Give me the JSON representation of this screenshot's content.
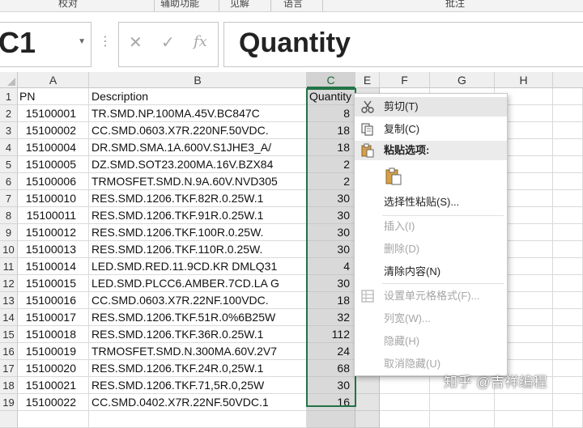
{
  "ribbon": {
    "groups": [
      "校对",
      "辅助功能",
      "见解",
      "语言",
      "批注"
    ]
  },
  "formula_bar": {
    "name_box": "C1",
    "formula": "Quantity",
    "cancel_glyph": "✕",
    "enter_glyph": "✓",
    "fx_glyph": "fx"
  },
  "columns": [
    "A",
    "B",
    "C",
    "E",
    "F",
    "G",
    "H"
  ],
  "header_row": {
    "row": "1",
    "pn": "PN",
    "description": "Description",
    "quantity": "Quantity"
  },
  "rows": [
    {
      "row": "2",
      "pn": "15100001",
      "description": "TR.SMD.NP.100MA.45V.BC847C",
      "quantity": "8"
    },
    {
      "row": "3",
      "pn": "15100002",
      "description": "CC.SMD.0603.X7R.220NF.50VDC.",
      "quantity": "18"
    },
    {
      "row": "4",
      "pn": "15100004",
      "description": "DR.SMD.SMA.1A.600V.S1JHE3_A/",
      "quantity": "18"
    },
    {
      "row": "5",
      "pn": "15100005",
      "description": "DZ.SMD.SOT23.200MA.16V.BZX84",
      "quantity": "2"
    },
    {
      "row": "6",
      "pn": "15100006",
      "description": "TRMOSFET.SMD.N.9A.60V.NVD305",
      "quantity": "2"
    },
    {
      "row": "7",
      "pn": "15100010",
      "description": "RES.SMD.1206.TKF.82R.0.25W.1",
      "quantity": "30"
    },
    {
      "row": "8",
      "pn": "15100011",
      "description": "RES.SMD.1206.TKF.91R.0.25W.1",
      "quantity": "30"
    },
    {
      "row": "9",
      "pn": "15100012",
      "description": "RES.SMD.1206.TKF.100R.0.25W.",
      "quantity": "30"
    },
    {
      "row": "10",
      "pn": "15100013",
      "description": "RES.SMD.1206.TKF.110R.0.25W.",
      "quantity": "30"
    },
    {
      "row": "11",
      "pn": "15100014",
      "description": "LED.SMD.RED.11.9CD.KR DMLQ31",
      "quantity": "4"
    },
    {
      "row": "12",
      "pn": "15100015",
      "description": "LED.SMD.PLCC6.AMBER.7CD.LA G",
      "quantity": "30"
    },
    {
      "row": "13",
      "pn": "15100016",
      "description": "CC.SMD.0603.X7R.22NF.100VDC.",
      "quantity": "18"
    },
    {
      "row": "14",
      "pn": "15100017",
      "description": "RES.SMD.1206.TKF.51R.0%6B25W",
      "quantity": "32"
    },
    {
      "row": "15",
      "pn": "15100018",
      "description": "RES.SMD.1206.TKF.36R.0.25W.1",
      "quantity": "112"
    },
    {
      "row": "16",
      "pn": "15100019",
      "description": "TRMOSFET.SMD.N.300MA.60V.2V7",
      "quantity": "24"
    },
    {
      "row": "17",
      "pn": "15100020",
      "description": "RES.SMD.1206.TKF.24R.0,25W.1",
      "quantity": "68"
    },
    {
      "row": "18",
      "pn": "15100021",
      "description": "RES.SMD.1206.TKF.71,5R.0,25W",
      "quantity": "30"
    },
    {
      "row": "19",
      "pn": "15100022",
      "description": "CC.SMD.0402.X7R.22NF.50VDC.1",
      "quantity": "16"
    }
  ],
  "context_menu": {
    "items": [
      {
        "label": "剪切(T)",
        "icon": "scissors-icon",
        "enabled": true,
        "highlight": true
      },
      {
        "label": "复制(C)",
        "icon": "copy-icon",
        "enabled": true
      },
      {
        "label": "粘贴选项:",
        "icon": "clipboard-icon",
        "header": true
      },
      {
        "label": "选择性粘贴(S)...",
        "enabled": true
      },
      {
        "label": "插入(I)",
        "enabled": false
      },
      {
        "label": "删除(D)",
        "enabled": false
      },
      {
        "label": "清除内容(N)",
        "enabled": true
      },
      {
        "label": "设置单元格格式(F)...",
        "icon": "format-cells-icon",
        "enabled": false
      },
      {
        "label": "列宽(W)...",
        "enabled": false
      },
      {
        "label": "隐藏(H)",
        "enabled": false
      },
      {
        "label": "取消隐藏(U)",
        "enabled": false
      }
    ]
  },
  "watermark": "知乎 @吉祥编程",
  "colors": {
    "accent": "#217346",
    "selected_fill": "#d9d9d9",
    "disabled_text": "#a6a6a6"
  }
}
